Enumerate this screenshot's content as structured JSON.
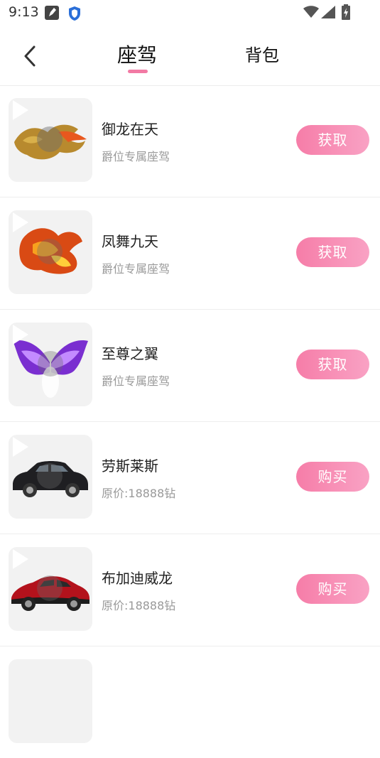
{
  "status_bar": {
    "time": "9:13"
  },
  "header": {
    "tabs": [
      {
        "label": "座驾",
        "active": true
      },
      {
        "label": "背包",
        "active": false
      }
    ],
    "accent_color": "#f27aa4"
  },
  "items": [
    {
      "title": "御龙在天",
      "subtitle": "爵位专属座驾",
      "button": "获取",
      "thumb_icon": "golden-dragon-icon"
    },
    {
      "title": "凤舞九天",
      "subtitle": "爵位专属座驾",
      "button": "获取",
      "thumb_icon": "fire-phoenix-icon"
    },
    {
      "title": "至尊之翼",
      "subtitle": "爵位专属座驾",
      "button": "获取",
      "thumb_icon": "purple-wings-icon"
    },
    {
      "title": "劳斯莱斯",
      "subtitle": "原价:18888钻",
      "button": "购买",
      "thumb_icon": "black-car-icon"
    },
    {
      "title": "布加迪威龙",
      "subtitle": "原价:18888钻",
      "button": "购买",
      "thumb_icon": "red-car-icon"
    }
  ]
}
